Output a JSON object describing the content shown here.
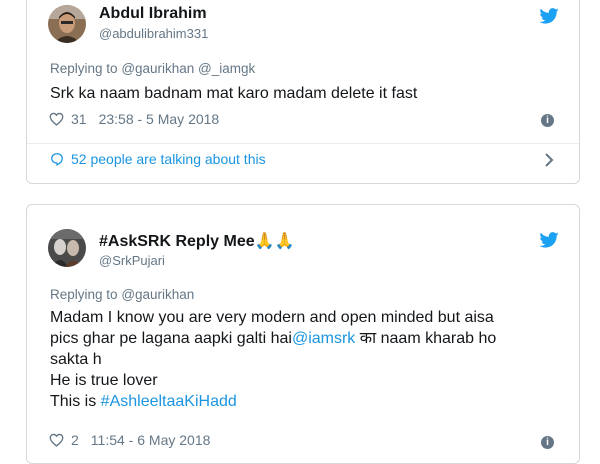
{
  "tweets": [
    {
      "name": "Abdul Ibrahim",
      "handle": "@abdulibrahim331",
      "replying_prefix": "Replying to",
      "replying_to": "@gaurikhan @_iamgk",
      "text": "Srk ka naam badnam mat karo madam delete it fast",
      "likes": "31",
      "timestamp": "23:58 - 5 May 2018",
      "talking": "52 people are talking about this"
    },
    {
      "name": "#AskSRK Reply Mee",
      "name_emoji": "🙏🙏",
      "handle": "@SrkPujari",
      "replying_prefix": "Replying to",
      "replying_to": "@gaurikhan",
      "text_line1": "Madam I know you are very modern and open minded but aisa",
      "text_line2_pre": "pics ghar pe lagana aapki galti hai",
      "text_line2_link": "@iamsrk",
      "text_line2_post": " का naam kharab ho",
      "text_line3": "sakta h",
      "text_line4": "He is true lover",
      "text_line5_pre": "This is ",
      "text_line5_link": "#AshleeltaaKiHadd",
      "likes": "2",
      "timestamp": "11:54 - 6 May 2018"
    }
  ],
  "icons": {
    "twitter": "twitter-bird-icon",
    "heart": "heart-icon",
    "info": "info-icon",
    "comment": "comment-bubble-icon",
    "chevron": "chevron-right-icon"
  },
  "colors": {
    "link": "#1b95e0",
    "muted": "#657786",
    "text": "#14171a",
    "border": "#d4d9de"
  }
}
